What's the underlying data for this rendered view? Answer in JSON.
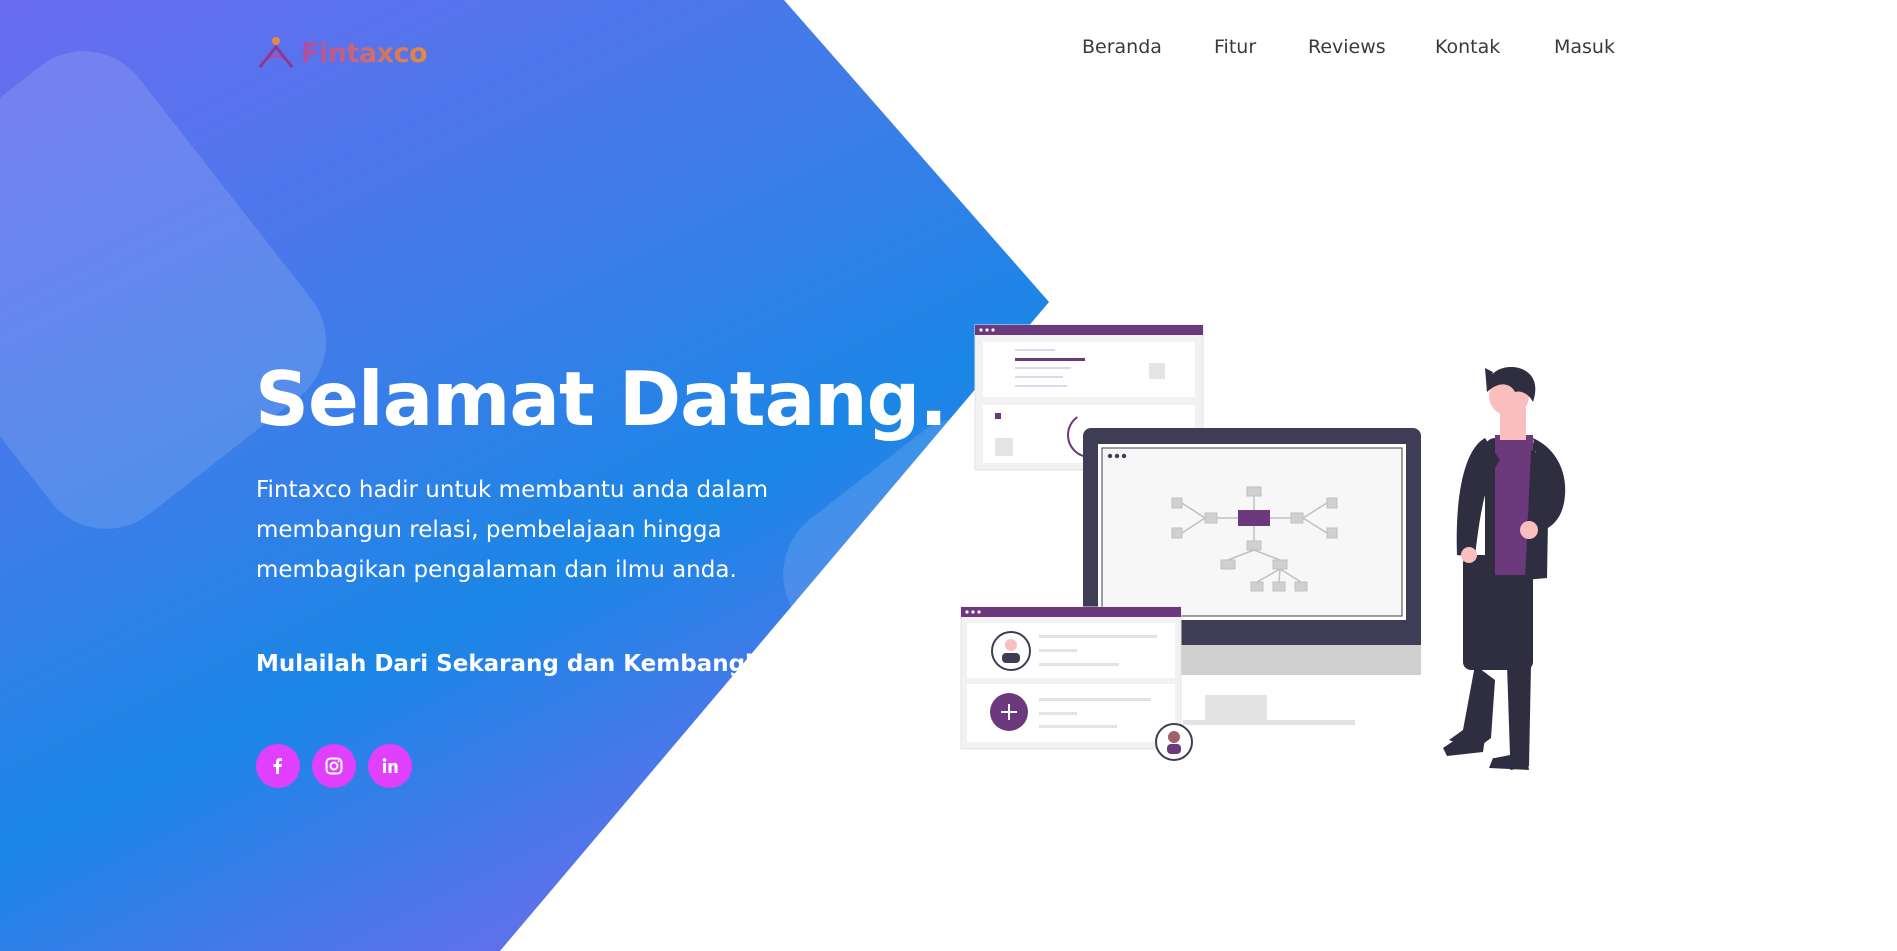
{
  "brand": {
    "name": "Fintaxco",
    "colors": {
      "logo_start": "#b24aa3",
      "logo_end": "#e58b3c"
    }
  },
  "nav": [
    {
      "label": "Beranda"
    },
    {
      "label": "Fitur"
    },
    {
      "label": "Reviews"
    },
    {
      "label": "Kontak"
    },
    {
      "label": "Masuk"
    }
  ],
  "hero": {
    "title": "Selamat Datang.",
    "description": "Fintaxco hadir untuk membantu anda dalam membangun relasi, pembelajaan hingga membagikan pengalaman dan ilmu anda.",
    "cta": "Mulailah Dari Sekarang dan Kembangkan Relasi",
    "gradient": [
      "#1a86e6",
      "#6a6cf0",
      "#c64cfa"
    ]
  },
  "socials": [
    {
      "icon": "facebook-icon"
    },
    {
      "icon": "instagram-icon"
    },
    {
      "icon": "linkedin-icon"
    }
  ],
  "accent_color": "#e040fb",
  "illustration": {
    "icon": "man-with-monitor-illustration"
  }
}
